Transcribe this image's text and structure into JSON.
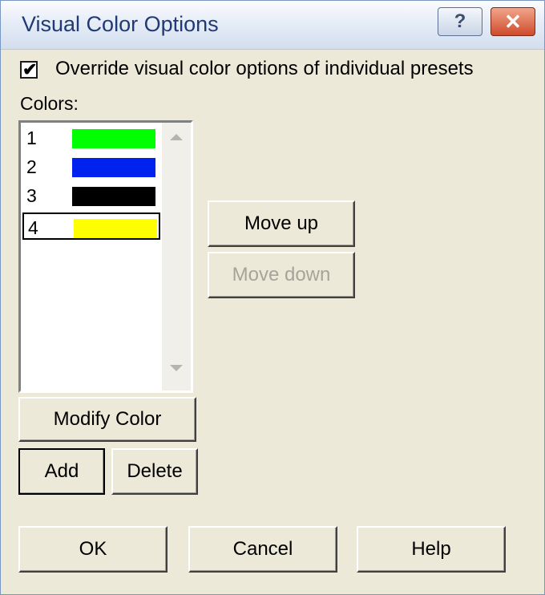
{
  "window": {
    "title": "Visual Color Options",
    "help_glyph": "?",
    "close_glyph": "✕"
  },
  "override": {
    "checked": true,
    "check_glyph": "✔",
    "label": "Override visual color options of individual presets"
  },
  "colors": {
    "label": "Colors:",
    "items": [
      {
        "number": "1",
        "color": "#00ff00",
        "selected": false
      },
      {
        "number": "2",
        "color": "#0022ee",
        "selected": false
      },
      {
        "number": "3",
        "color": "#000000",
        "selected": false
      },
      {
        "number": "4",
        "color": "#ffff00",
        "selected": true
      }
    ]
  },
  "buttons": {
    "move_up": "Move up",
    "move_down": "Move down",
    "modify_color": "Modify Color",
    "add": "Add",
    "delete": "Delete",
    "ok": "OK",
    "cancel": "Cancel",
    "help": "Help"
  }
}
